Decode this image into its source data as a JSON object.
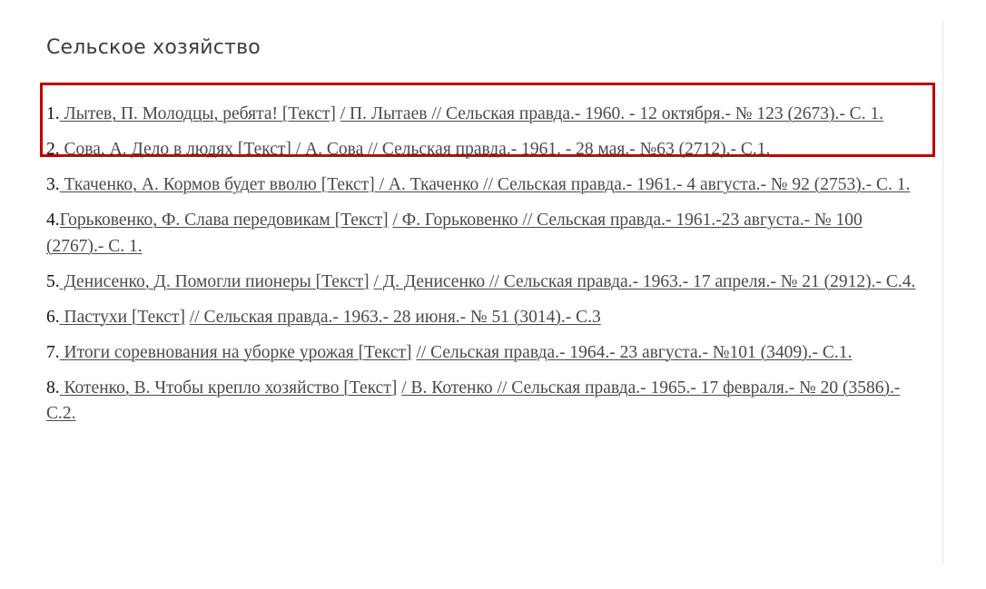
{
  "section": {
    "title": "Сельское хозяйство"
  },
  "colors": {
    "highlight": "#c00000",
    "link": "#4a4a4a"
  },
  "entries": [
    {
      "num": "1.",
      "link1": " Лытев, П. Молодцы, ребята! [Текст]",
      "sep": " ",
      "link2": "/ П. Лытаев // Сельская правда.- 1960. - 12 октября.- № 123 (2673).- С. 1."
    },
    {
      "num": "2.",
      "link1": " Сова, А. Дело в людях [Текст] / А. Сова // Сельская правда.- 1961. - 28 мая.- №63 (2712).- С.1.",
      "sep": "",
      "link2": ""
    },
    {
      "num": "3.",
      "link1": " Ткаченко, А. Кормов будет вволю [Текст] / А. Ткаченко // Сельская правда.- 1961.- 4 августа.- № 92 (2753).- С. 1.",
      "sep": "",
      "link2": ""
    },
    {
      "num": "4.",
      "link1": "Горьковенко, Ф. Слава передовикам [Текст]",
      "sep": " ",
      "link2": "/ Ф. Горьковенко // Сельская правда.- 1961.-23 августа.- № 100 (2767).- С. 1."
    },
    {
      "num": "5.",
      "link1": " Денисенко,  Д. Помогли пионеры [Текст]",
      "sep": " ",
      "link2": " / Д. Денисенко // Сельская правда.- 1963.- 17 апреля.- № 21 (2912).- С.4."
    },
    {
      "num": "6.",
      "link1": " Пастухи [Текст]",
      "sep": " ",
      "link2": "// Сельская правда.- 1963.- 28 июня.- № 51 (3014).- С.3"
    },
    {
      "num": "7.",
      "link1": " Итоги соревнования  на уборке урожая [Текст]",
      "sep": " ",
      "link2": "// Сельская правда.- 1964.- 23 августа.- №101 (3409).- С.1."
    },
    {
      "num": "8.",
      "link1": " Котенко, В. Чтобы крепло хозяйство [Текст]",
      "sep": " ",
      "link2": "/ В. Котенко // Сельская правда.- 1965.- 17 февраля.- № 20 (3586).- С.2."
    }
  ]
}
